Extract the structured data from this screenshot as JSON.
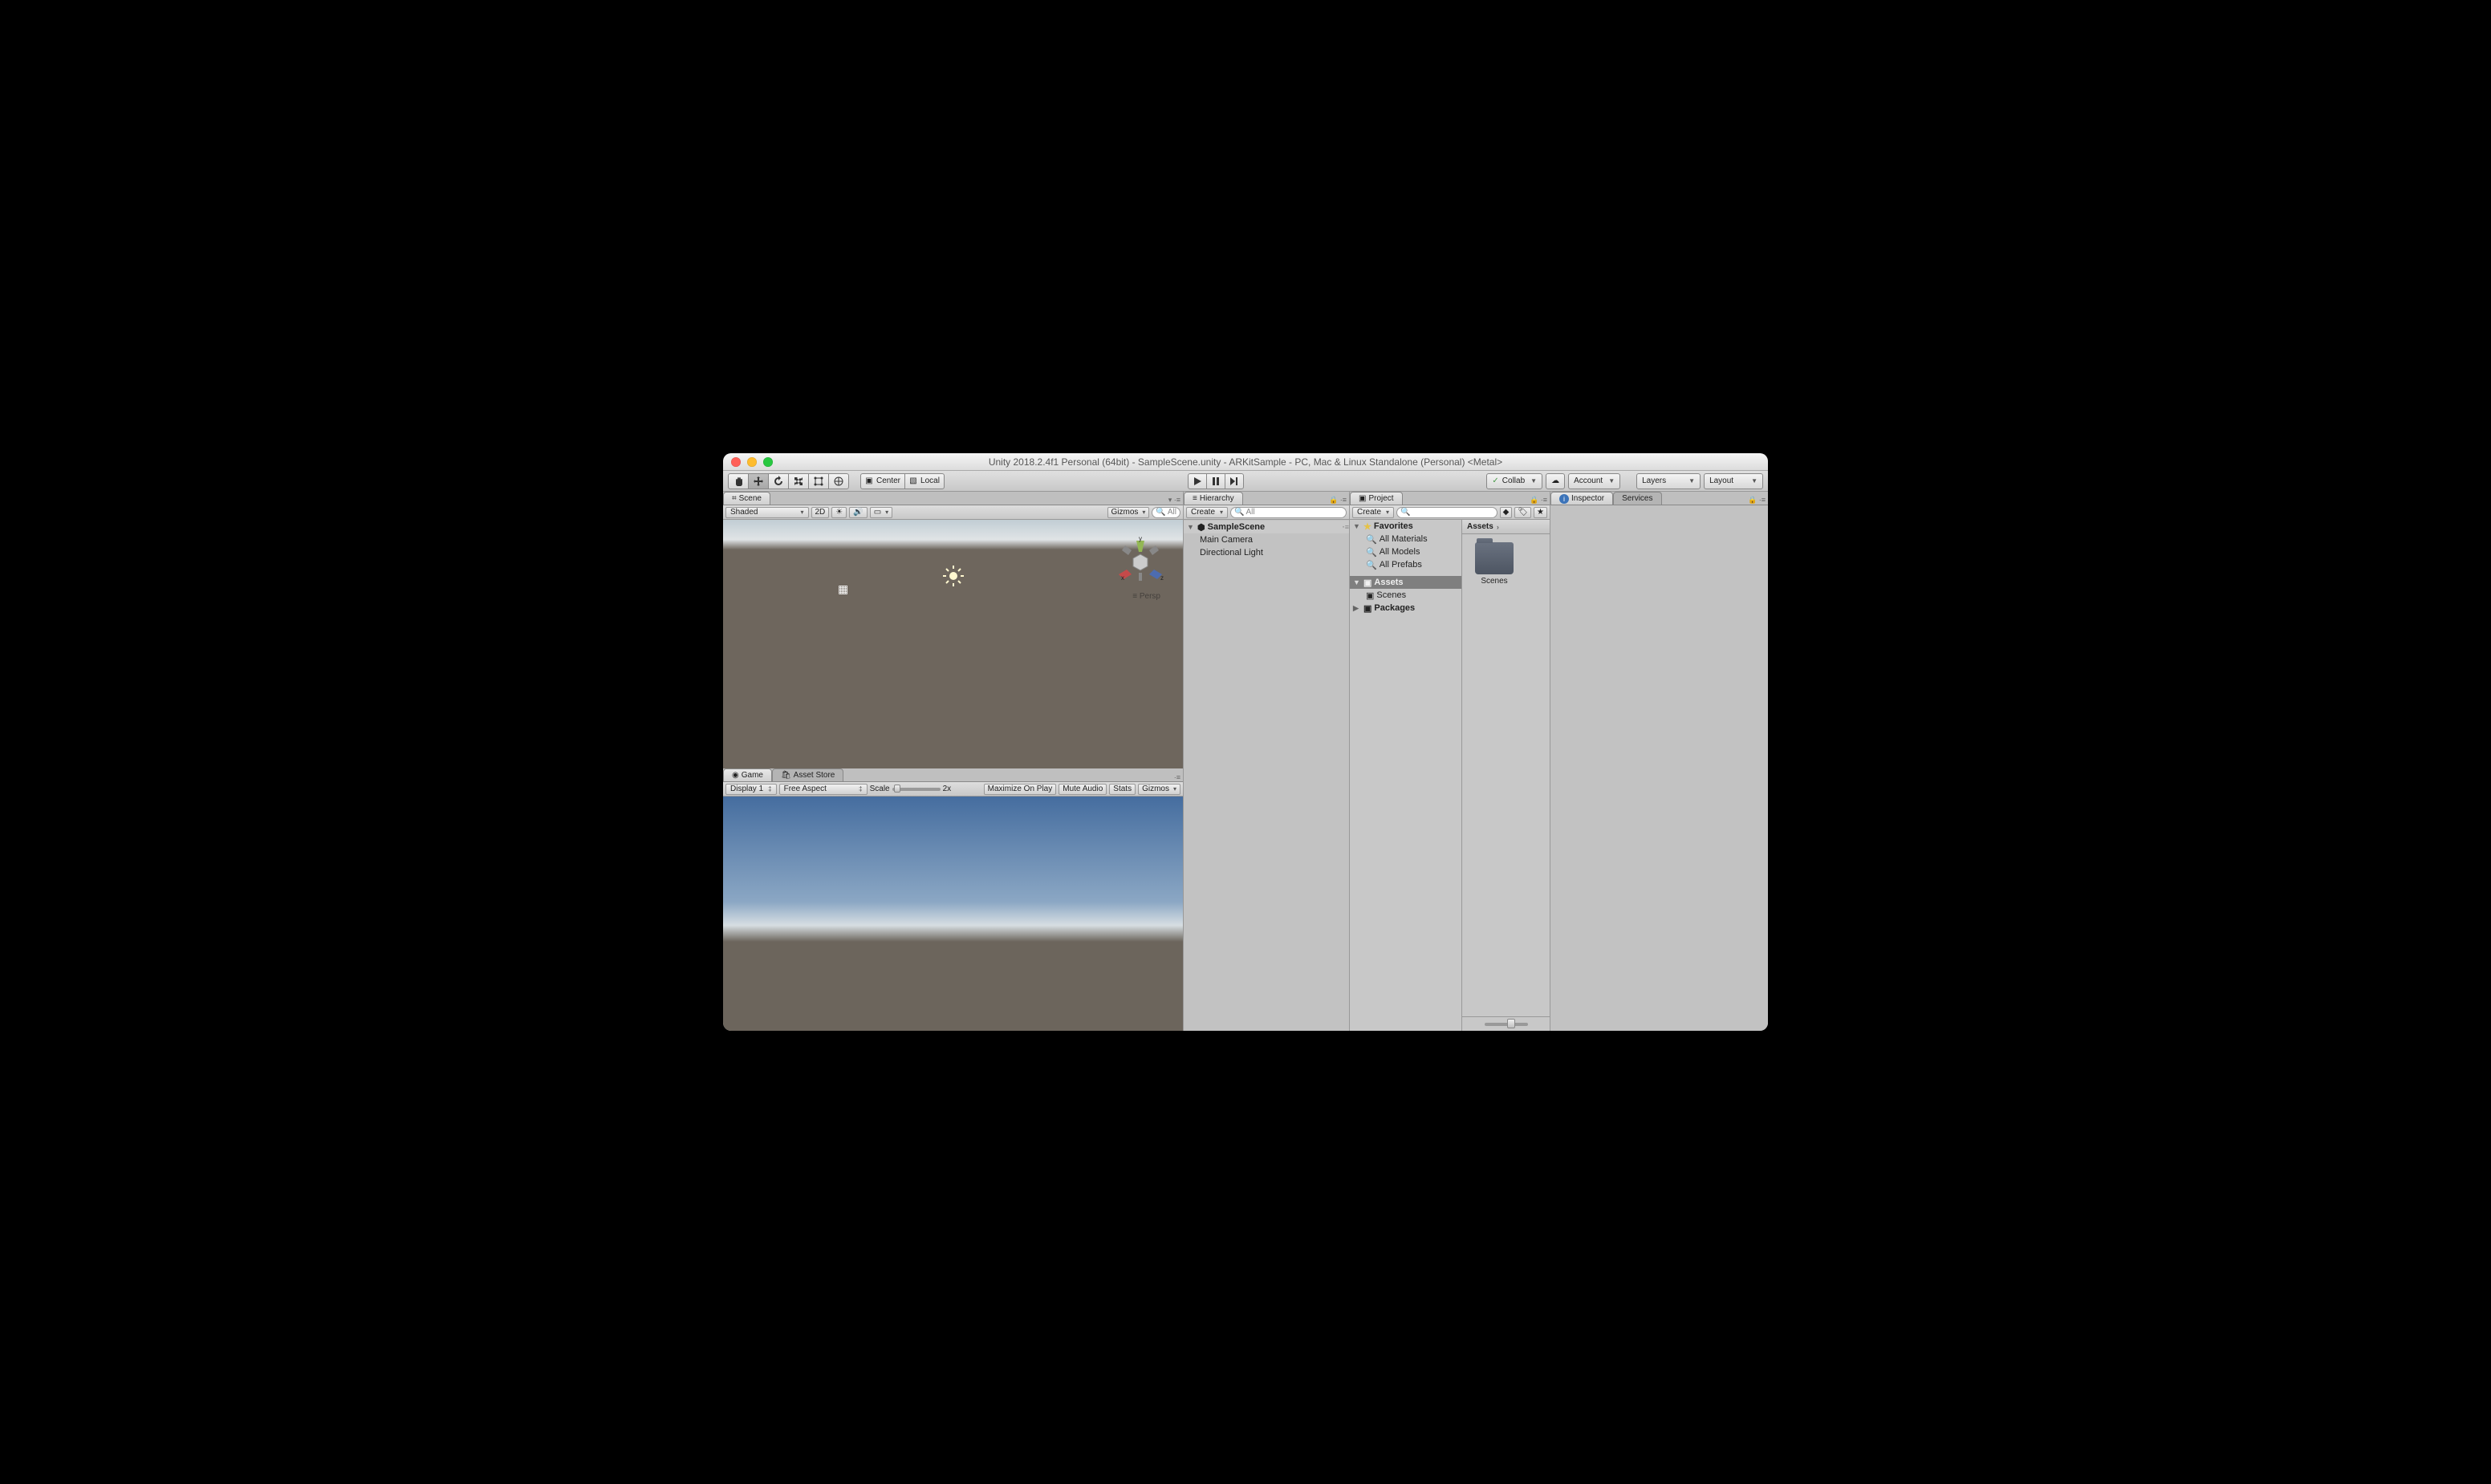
{
  "window": {
    "title": "Unity 2018.2.4f1 Personal (64bit) - SampleScene.unity - ARKitSample - PC, Mac & Linux Standalone (Personal) <Metal>",
    "traffic": {
      "close": "#ff5f57",
      "min": "#febc2e",
      "max": "#28c840"
    }
  },
  "toolbar": {
    "pivot": "Center",
    "space": "Local",
    "collab": "Collab",
    "account": "Account",
    "layers": "Layers",
    "layout": "Layout"
  },
  "scene_panel": {
    "tab": "Scene",
    "shade": "Shaded",
    "twoD": "2D",
    "gizmos": "Gizmos",
    "search_placeholder": "All",
    "persp": "Persp",
    "axes": {
      "x": "x",
      "y": "y",
      "z": "z"
    }
  },
  "game_panel": {
    "tab_game": "Game",
    "tab_store": "Asset Store",
    "display": "Display 1",
    "aspect": "Free Aspect",
    "scale": "Scale",
    "scale_value": "2x",
    "max": "Maximize On Play",
    "mute": "Mute Audio",
    "stats": "Stats",
    "gizmos": "Gizmos"
  },
  "hierarchy": {
    "tab": "Hierarchy",
    "create": "Create",
    "search_placeholder": "All",
    "scene": "SampleScene",
    "items": [
      "Main Camera",
      "Directional Light"
    ]
  },
  "project": {
    "tab": "Project",
    "create": "Create",
    "favorites": "Favorites",
    "fav_items": [
      "All Materials",
      "All Models",
      "All Prefabs"
    ],
    "assets_header": "Assets",
    "folders": [
      "Scenes"
    ],
    "packages": "Packages",
    "breadcrumb": "Assets",
    "grid_items": [
      {
        "name": "Scenes"
      }
    ]
  },
  "inspector": {
    "tab_inspector": "Inspector",
    "tab_services": "Services"
  }
}
